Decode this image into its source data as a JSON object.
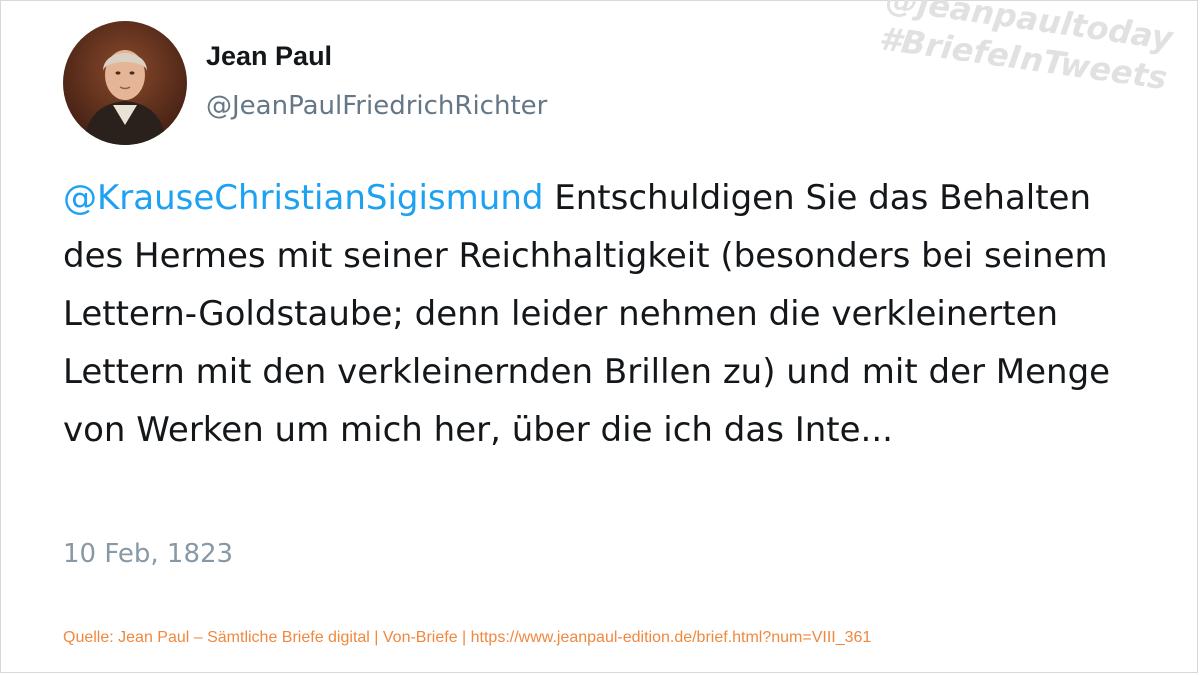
{
  "author": {
    "name": "Jean Paul",
    "handle": "@JeanPaulFriedrichRichter"
  },
  "watermark": {
    "line1": "@jeanpaultoday",
    "line2": "#BriefeInTweets"
  },
  "tweet": {
    "mention": "@KrauseChristianSigismund",
    "text": " Entschuldigen Sie das Behalten des Hermes mit seiner Reichhaltigkeit (besonders bei seinem Lettern-Goldstaube; denn leider nehmen die verkleinerten Lettern mit den verkleinernden Brillen zu) und mit der Menge von Werken um mich her, über die ich das Inte...",
    "date": "10 Feb, 1823"
  },
  "source": "Quelle: Jean Paul – Sämtliche Briefe digital | Von-Briefe | https://www.jeanpaul-edition.de/brief.html?num=VIII_361",
  "colors": {
    "mention": "#1da1f2",
    "text": "#14171a",
    "handle": "#657786",
    "date": "#8899a6",
    "source": "#f0883e",
    "watermark": "#e1e1e1"
  }
}
